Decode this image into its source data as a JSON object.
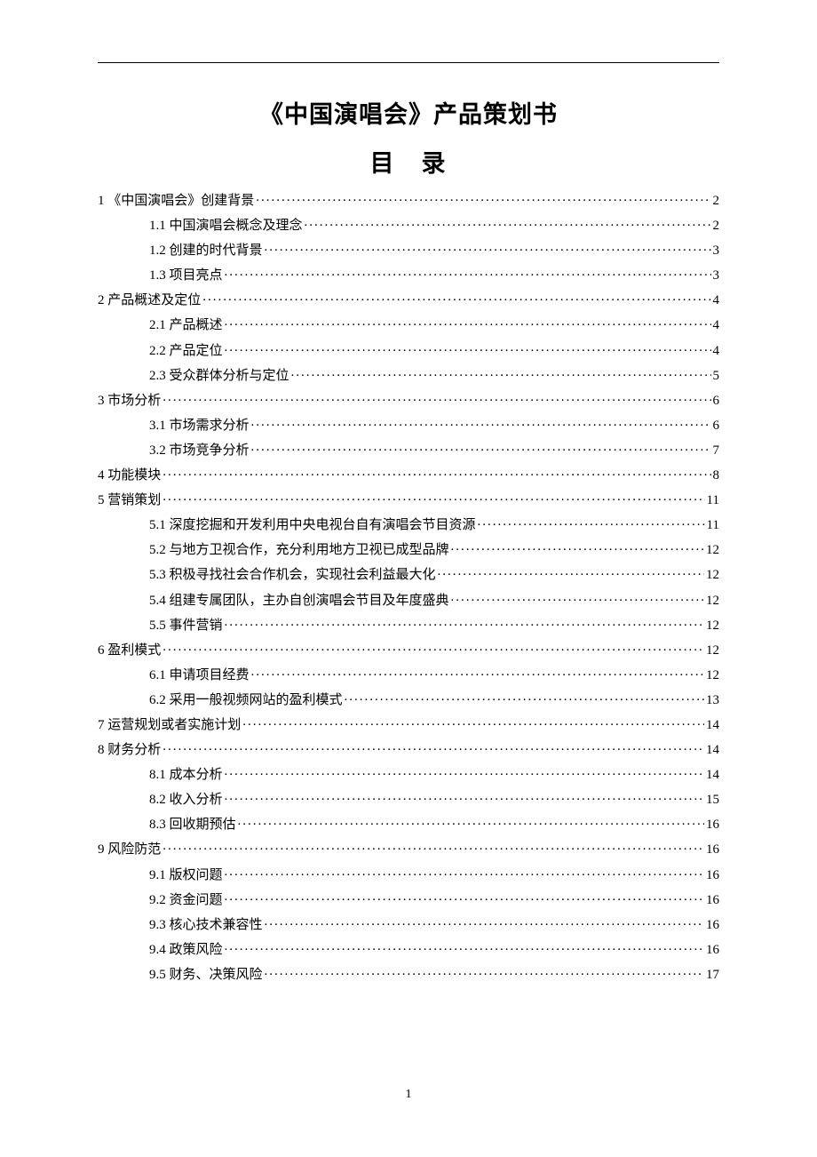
{
  "doc_title": "《中国演唱会》产品策划书",
  "toc_heading": "目　录",
  "page_number": "1",
  "toc": [
    {
      "level": 1,
      "label": "1 《中国演唱会》创建背景",
      "page": "2"
    },
    {
      "level": 2,
      "label": "1.1 中国演唱会概念及理念",
      "page": "2"
    },
    {
      "level": 2,
      "label": "1.2 创建的时代背景",
      "page": "3"
    },
    {
      "level": 2,
      "label": "1.3 项目亮点",
      "page": "3"
    },
    {
      "level": 1,
      "label": "2 产品概述及定位",
      "page": "4"
    },
    {
      "level": 2,
      "label": "2.1 产品概述",
      "page": "4"
    },
    {
      "level": 2,
      "label": "2.2 产品定位",
      "page": "4"
    },
    {
      "level": 2,
      "label": "2.3 受众群体分析与定位",
      "page": "5"
    },
    {
      "level": 1,
      "label": "3 市场分析",
      "page": "6"
    },
    {
      "level": 2,
      "label": "3.1 市场需求分析",
      "page": "6"
    },
    {
      "level": 2,
      "label": "3.2 市场竞争分析",
      "page": "7"
    },
    {
      "level": 1,
      "label": "4 功能模块",
      "page": "8"
    },
    {
      "level": 1,
      "label": "5 营销策划",
      "page": "11"
    },
    {
      "level": 2,
      "label": "5.1 深度挖掘和开发利用中央电视台自有演唱会节目资源",
      "page": "11"
    },
    {
      "level": 2,
      "label": "5.2 与地方卫视合作，充分利用地方卫视已成型品牌",
      "page": "12"
    },
    {
      "level": 2,
      "label": "5.3 积极寻找社会合作机会，实现社会利益最大化",
      "page": "12"
    },
    {
      "level": 2,
      "label": "5.4 组建专属团队，主办自创演唱会节目及年度盛典",
      "page": "12"
    },
    {
      "level": 2,
      "label": "5.5 事件营销",
      "page": "12"
    },
    {
      "level": 1,
      "label": "6 盈利模式",
      "page": "12"
    },
    {
      "level": 2,
      "label": "6.1 申请项目经费",
      "page": "12"
    },
    {
      "level": 2,
      "label": "6.2 采用一般视频网站的盈利模式",
      "page": "13"
    },
    {
      "level": 1,
      "label": "7 运营规划或者实施计划",
      "page": "14"
    },
    {
      "level": 1,
      "label": "8 财务分析",
      "page": "14"
    },
    {
      "level": 2,
      "label": "8.1 成本分析",
      "page": "14"
    },
    {
      "level": 2,
      "label": "8.2 收入分析",
      "page": "15"
    },
    {
      "level": 2,
      "label": "8.3 回收期预估",
      "page": "16"
    },
    {
      "level": 1,
      "label": "9 风险防范",
      "page": "16"
    },
    {
      "level": 2,
      "label": "9.1 版权问题",
      "page": "16"
    },
    {
      "level": 2,
      "label": "9.2 资金问题",
      "page": "16"
    },
    {
      "level": 2,
      "label": "9.3 核心技术兼容性",
      "page": "16"
    },
    {
      "level": 2,
      "label": "9.4 政策风险",
      "page": "16"
    },
    {
      "level": 2,
      "label": "9.5 财务、决策风险",
      "page": "17"
    }
  ]
}
